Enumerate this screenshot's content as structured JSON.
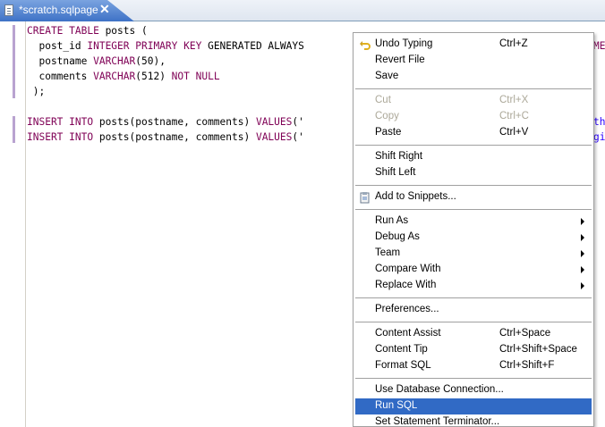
{
  "tab": {
    "title": "*scratch.sqlpage",
    "close": "✕"
  },
  "editor": {
    "lines": [
      [
        {
          "t": "CREATE TABLE ",
          "c": "kw"
        },
        {
          "t": "posts (",
          "c": ""
        }
      ],
      [
        {
          "t": "  post_id ",
          "c": ""
        },
        {
          "t": "INTEGER PRIMARY KEY ",
          "c": "kw"
        },
        {
          "t": "GENERATED ALWAYS",
          "c": ""
        }
      ],
      [
        {
          "t": "  postname ",
          "c": ""
        },
        {
          "t": "VARCHAR",
          "c": "kw"
        },
        {
          "t": "(50),",
          "c": ""
        }
      ],
      [
        {
          "t": "  comments ",
          "c": ""
        },
        {
          "t": "VARCHAR",
          "c": "kw"
        },
        {
          "t": "(512) ",
          "c": ""
        },
        {
          "t": "NOT NULL",
          "c": "kw"
        }
      ],
      [
        {
          "t": " );",
          "c": ""
        }
      ],
      [],
      [
        {
          "t": "INSERT INTO ",
          "c": "kw"
        },
        {
          "t": "posts(postname, comments) ",
          "c": ""
        },
        {
          "t": "VALUES",
          "c": "kw"
        },
        {
          "t": "('",
          "c": ""
        }
      ],
      [
        {
          "t": "INSERT INTO ",
          "c": "kw"
        },
        {
          "t": "posts(postname, comments) ",
          "c": ""
        },
        {
          "t": "VALUES",
          "c": "kw"
        },
        {
          "t": "('",
          "c": ""
        }
      ]
    ],
    "overflow_right": [
      {
        "t": "ME",
        "c": "kw"
      },
      {
        "t": "th",
        "c": "str"
      },
      {
        "t": "gi",
        "c": "str"
      }
    ]
  },
  "menu": {
    "items": [
      {
        "label": "Undo Typing",
        "accel": "Ctrl+Z",
        "icon": "undo-icon"
      },
      {
        "label": "Revert File",
        "accel": ""
      },
      {
        "label": "Save",
        "accel": ""
      },
      {
        "sep": true
      },
      {
        "label": "Cut",
        "accel": "Ctrl+X",
        "disabled": true
      },
      {
        "label": "Copy",
        "accel": "Ctrl+C",
        "disabled": true
      },
      {
        "label": "Paste",
        "accel": "Ctrl+V"
      },
      {
        "sep": true
      },
      {
        "label": "Shift Right",
        "accel": ""
      },
      {
        "label": "Shift Left",
        "accel": ""
      },
      {
        "sep": true
      },
      {
        "label": "Add to Snippets...",
        "accel": "",
        "icon": "snippets-icon"
      },
      {
        "sep": true
      },
      {
        "label": "Run As",
        "accel": "",
        "submenu": true
      },
      {
        "label": "Debug As",
        "accel": "",
        "submenu": true
      },
      {
        "label": "Team",
        "accel": "",
        "submenu": true
      },
      {
        "label": "Compare With",
        "accel": "",
        "submenu": true
      },
      {
        "label": "Replace With",
        "accel": "",
        "submenu": true
      },
      {
        "sep": true
      },
      {
        "label": "Preferences...",
        "accel": ""
      },
      {
        "sep": true
      },
      {
        "label": "Content Assist",
        "accel": "Ctrl+Space"
      },
      {
        "label": "Content Tip",
        "accel": "Ctrl+Shift+Space"
      },
      {
        "label": "Format SQL",
        "accel": "Ctrl+Shift+F"
      },
      {
        "sep": true
      },
      {
        "label": "Use Database Connection...",
        "accel": ""
      },
      {
        "label": "Run SQL",
        "accel": "",
        "selected": true
      },
      {
        "label": "Set Statement Terminator...",
        "accel": ""
      }
    ]
  },
  "colors": {
    "keyword": "#7f0055",
    "string": "#2a00ff",
    "selection": "#316ac5"
  }
}
